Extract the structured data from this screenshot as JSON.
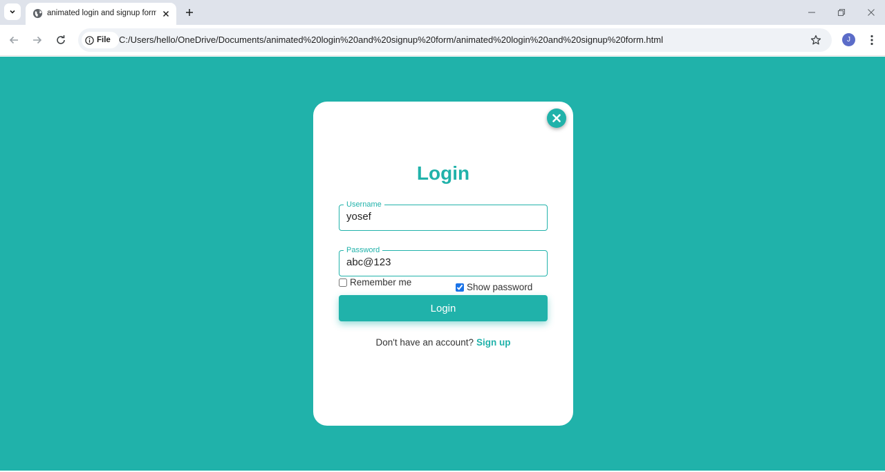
{
  "browser": {
    "tab_title": "animated login and signup form",
    "url_chip": "File",
    "url": "C:/Users/hello/OneDrive/Documents/animated%20login%20and%20signup%20form/animated%20login%20and%20signup%20form.html",
    "profile_initial": "J"
  },
  "form": {
    "heading": "Login",
    "username_label": "Username",
    "username_value": "yosef",
    "password_label": "Password",
    "password_value": "abc@123",
    "remember_label": "Remember me",
    "remember_checked": false,
    "show_password_label": "Show password",
    "show_password_checked": true,
    "submit_label": "Login",
    "signup_prompt": "Don't have an account?",
    "signup_link": "Sign up"
  },
  "colors": {
    "accent": "#20b2aa",
    "card": "#ffffff",
    "checkbox_checked": "#1a73e8"
  }
}
